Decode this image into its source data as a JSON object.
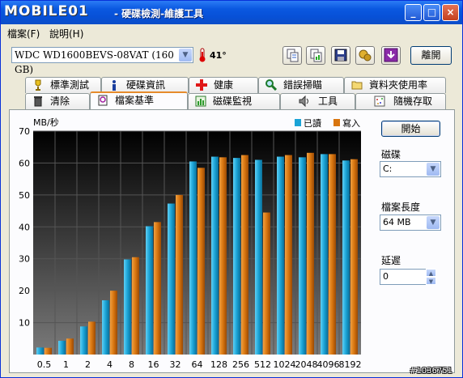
{
  "window": {
    "logo_text": "MOBILE01",
    "title": "- 硬碟檢測-維護工具",
    "minimize": "_",
    "maximize": "□",
    "close": "×"
  },
  "menu": [
    {
      "label": "檔案(F)"
    },
    {
      "label": "說明(H)"
    }
  ],
  "toolbar": {
    "drive": "WDC WD1600BEVS-08VAT (160 GB)",
    "temperature": "41°",
    "exit_label": "離開",
    "icons": [
      "copy-text-icon",
      "copy-graph-icon",
      "save-icon",
      "options-icon",
      "download-icon"
    ]
  },
  "tabs_row1": [
    {
      "label": "標準測試",
      "icon": "trophy-icon"
    },
    {
      "label": "硬碟資訊",
      "icon": "info-icon"
    },
    {
      "label": "健康",
      "icon": "health-cross-icon"
    },
    {
      "label": "錯誤掃瞄",
      "icon": "magnifier-icon"
    },
    {
      "label": "資料夾使用率",
      "icon": "folder-icon"
    }
  ],
  "tabs_row2": [
    {
      "label": "清除",
      "icon": "trash-icon"
    },
    {
      "label": "檔案基準",
      "icon": "file-benchmark-icon",
      "active": true
    },
    {
      "label": "磁碟監視",
      "icon": "monitor-chart-icon"
    },
    {
      "label": "工具",
      "icon": "speaker-tool-icon"
    },
    {
      "label": "隨機存取",
      "icon": "random-access-icon"
    }
  ],
  "controls": {
    "start_label": "開始",
    "disk_label": "磁碟",
    "disk_value": "C:",
    "file_length_label": "檔案長度",
    "file_length_value": "64 MB",
    "delay_label": "延遲",
    "delay_value": "0"
  },
  "colors": {
    "read": "#1aa3d6",
    "write": "#d8750f",
    "chart_bg_top": "#000000",
    "chart_bg_bottom": "#7a7a7a"
  },
  "watermark": "#1036751",
  "chart_data": {
    "type": "bar",
    "ylabel": "MB/秒",
    "ylim": [
      0,
      70
    ],
    "yticks": [
      10,
      20,
      30,
      40,
      50,
      60,
      70
    ],
    "grid": true,
    "legend_position": "top-right",
    "categories": [
      "0.5",
      "1",
      "2",
      "4",
      "8",
      "16",
      "32",
      "64",
      "128",
      "256",
      "512",
      "1024",
      "2048",
      "4096",
      "8192"
    ],
    "series": [
      {
        "name": "已讀",
        "values": [
          2.2,
          4.3,
          8.8,
          17.0,
          29.8,
          40.2,
          47.3,
          60.5,
          62.0,
          61.6,
          61.0,
          62.0,
          61.8,
          62.8,
          60.8
        ]
      },
      {
        "name": "寫入",
        "values": [
          2.1,
          5.0,
          10.3,
          20.0,
          30.5,
          41.5,
          50.0,
          58.5,
          61.8,
          62.5,
          44.5,
          62.5,
          63.2,
          62.8,
          61.2
        ]
      }
    ]
  }
}
